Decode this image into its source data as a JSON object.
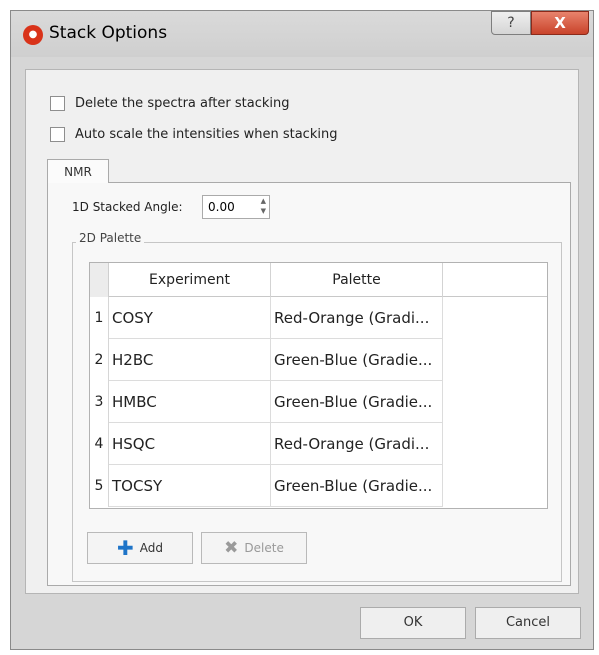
{
  "window": {
    "title": "Stack Options",
    "help_label": "?",
    "close_label": "X"
  },
  "options": {
    "delete_spectra": {
      "label": "Delete the spectra after stacking",
      "checked": false
    },
    "auto_scale": {
      "label": "Auto scale the intensities when stacking",
      "checked": false
    }
  },
  "tabs": {
    "nmr": "NMR"
  },
  "angle": {
    "label": "1D Stacked Angle:",
    "value": "0.00"
  },
  "palette_group": {
    "title": "2D Palette",
    "columns": [
      "Experiment",
      "Palette"
    ],
    "rows": [
      {
        "num": "1",
        "experiment": "COSY",
        "palette": "Red-Orange (Gradi..."
      },
      {
        "num": "2",
        "experiment": "H2BC",
        "palette": "Green-Blue (Gradie..."
      },
      {
        "num": "3",
        "experiment": "HMBC",
        "palette": "Green-Blue (Gradie..."
      },
      {
        "num": "4",
        "experiment": "HSQC",
        "palette": "Red-Orange (Gradi..."
      },
      {
        "num": "5",
        "experiment": "TOCSY",
        "palette": "Green-Blue (Gradie..."
      }
    ],
    "add_label": "Add",
    "delete_label": "Delete"
  },
  "footer": {
    "ok_label": "OK",
    "cancel_label": "Cancel"
  },
  "colors": {
    "accent": "#1e74c8",
    "close": "#c9432a",
    "app_icon": "#d9331a"
  }
}
